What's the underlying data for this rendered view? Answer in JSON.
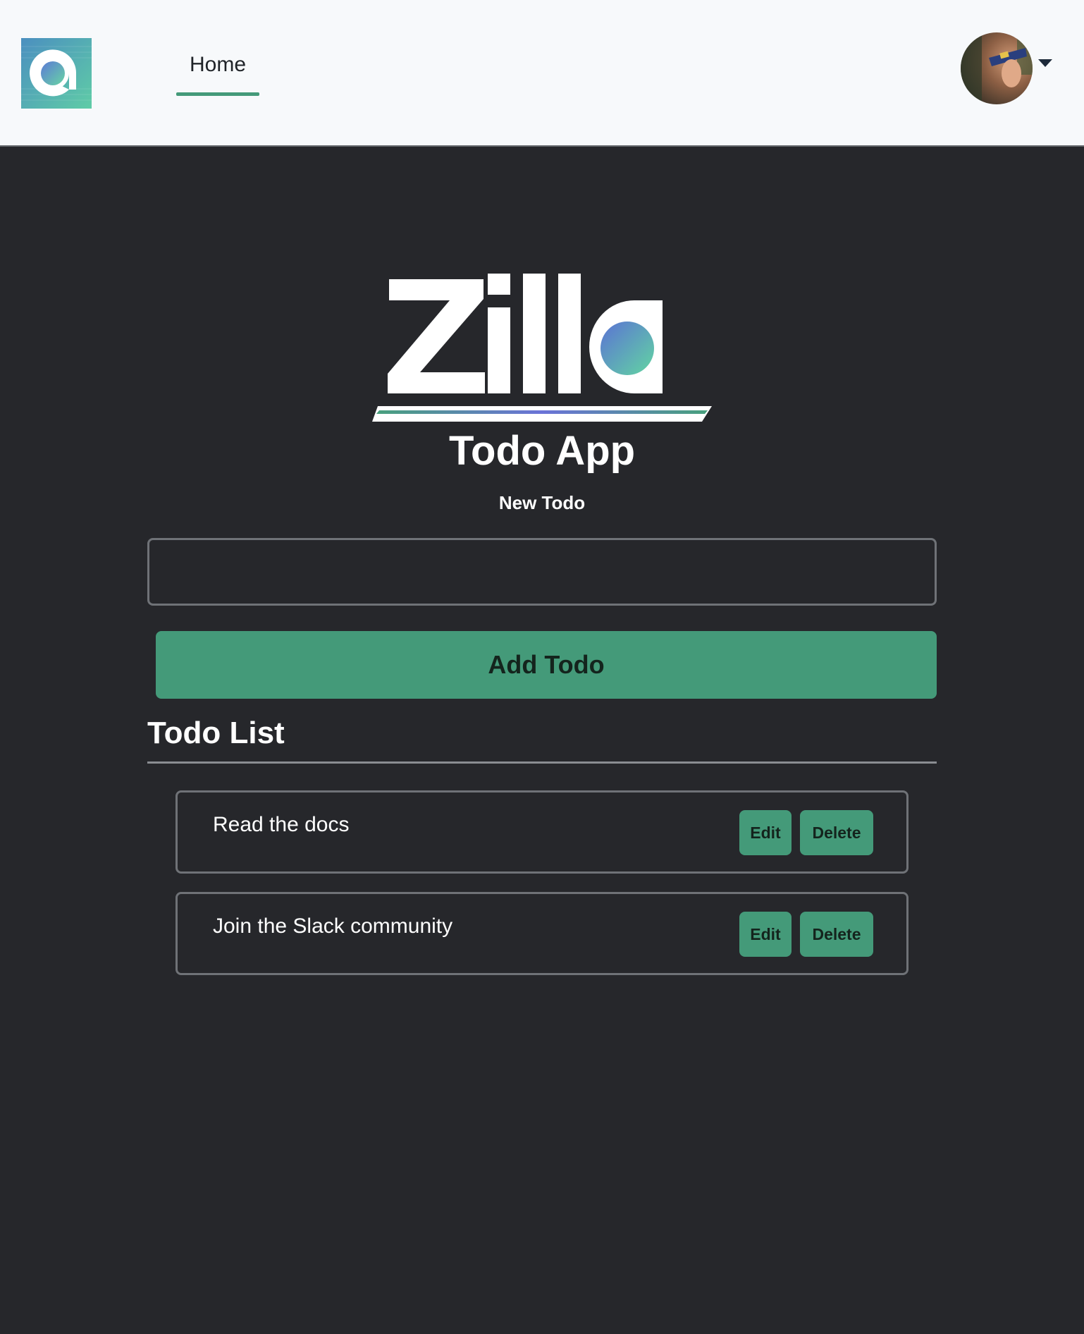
{
  "nav": {
    "brand_logo_icon": "brand-a-logo-icon",
    "home_label": "Home",
    "avatar_icon": "user-avatar-photo",
    "menu_icon": "caret-down-icon"
  },
  "logo": {
    "wordmark": "Zilla"
  },
  "main": {
    "title": "Todo App",
    "new_label": "New Todo",
    "input_value": "",
    "add_button_label": "Add Todo",
    "list_heading": "Todo List"
  },
  "todos": [
    {
      "text": "Read the docs",
      "edit_label": "Edit",
      "delete_label": "Delete"
    },
    {
      "text": "Join the Slack community",
      "edit_label": "Edit",
      "delete_label": "Delete"
    }
  ],
  "colors": {
    "accent": "#449a79",
    "background": "#26272b",
    "navbar": "#f7f9fb",
    "border": "#6f7277"
  }
}
